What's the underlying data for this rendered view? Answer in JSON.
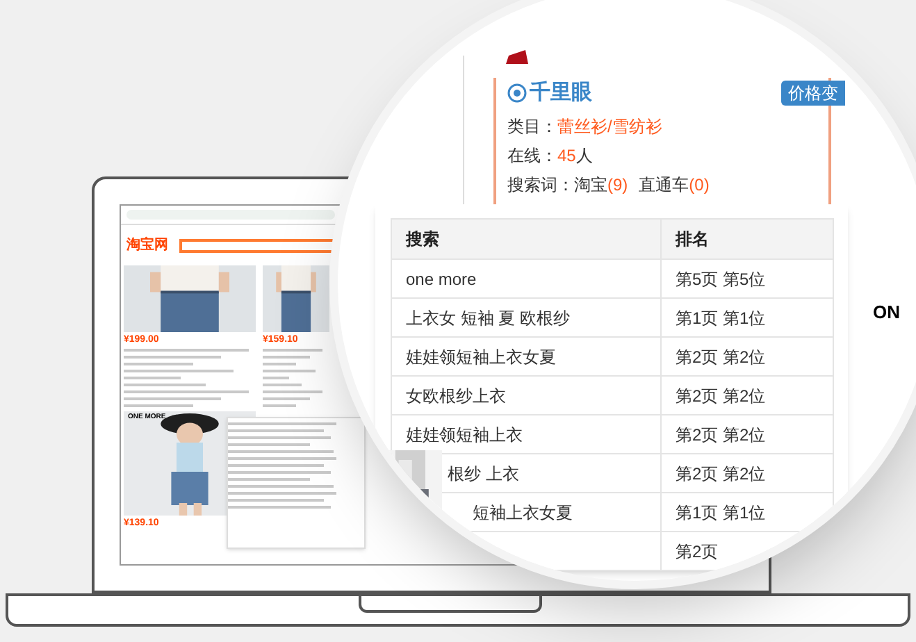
{
  "laptop_screen": {
    "logo": "淘宝网",
    "products": [
      {
        "price": "¥199.00"
      },
      {
        "price": "¥159.10"
      },
      {
        "price": "¥139.10",
        "brand": "ONE MORE"
      }
    ]
  },
  "magnifier": {
    "card": {
      "title": "千里眼",
      "badge": "价格变",
      "category": {
        "label": "类目：",
        "value": "蕾丝衫/雪纺衫"
      },
      "online": {
        "label": "在线：",
        "value": "45",
        "unit": "人"
      },
      "search_words": {
        "label": "搜索词：",
        "sources": [
          {
            "name": "淘宝",
            "count": "(9)"
          },
          {
            "name": "直通车",
            "count": "(0)"
          }
        ]
      }
    },
    "side_text": "ON",
    "table": {
      "columns": [
        "搜索",
        "排名"
      ],
      "rows": [
        [
          "one more",
          "第5页 第5位"
        ],
        [
          "上衣女 短袖 夏 欧根纱",
          "第1页 第1位"
        ],
        [
          "娃娃领短袖上衣女夏",
          "第2页 第2位"
        ],
        [
          "女欧根纱上衣",
          "第2页 第2位"
        ],
        [
          "娃娃领短袖上衣",
          "第2页 第2位"
        ],
        [
          "根纱 上衣",
          "第2页 第2位"
        ],
        [
          "短袖上衣女夏",
          "第1页 第1位"
        ],
        [
          "",
          "第2页"
        ]
      ]
    }
  }
}
